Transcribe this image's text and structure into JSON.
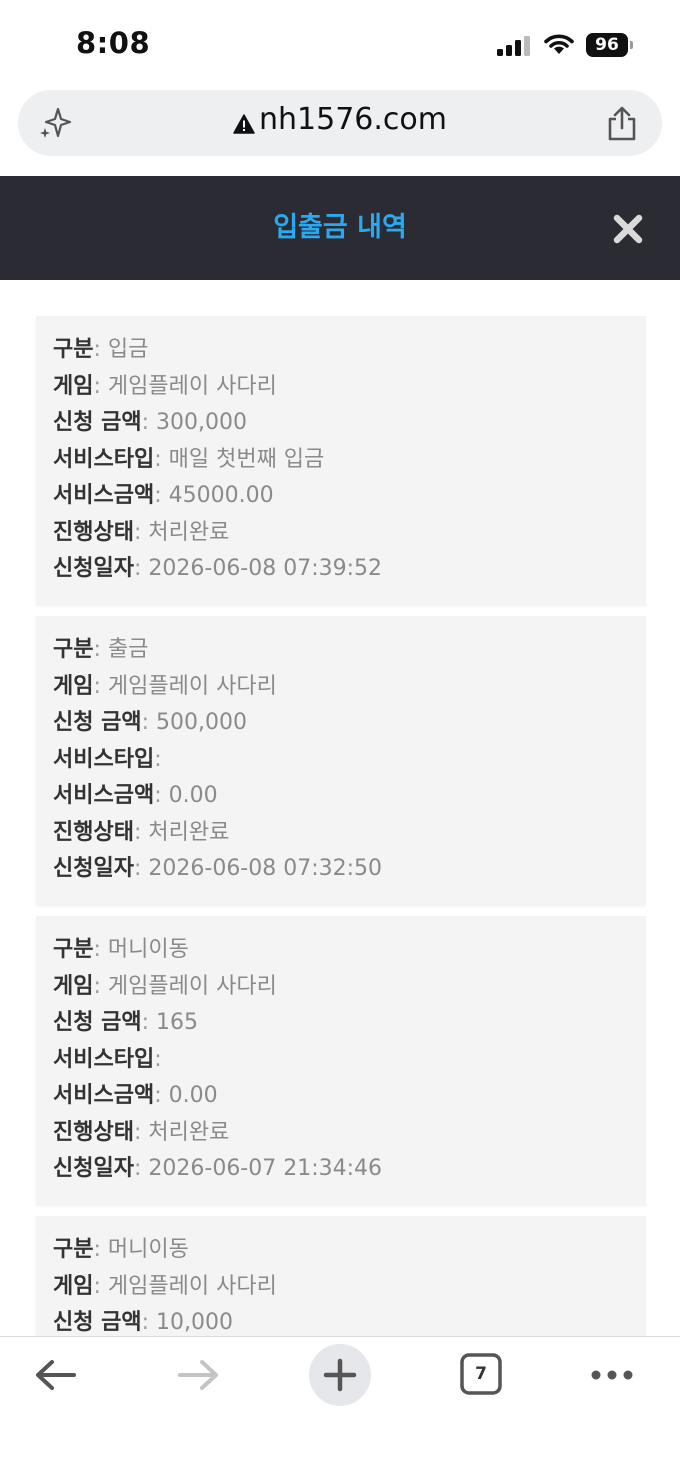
{
  "status_bar": {
    "time": "8:08",
    "battery": "96",
    "icons": [
      "cellular-signal-icon",
      "wifi-icon",
      "battery-icon"
    ]
  },
  "browser": {
    "url": "nh1576.com",
    "icons": [
      "sparkle-icon",
      "not-secure-warning-icon",
      "share-icon"
    ]
  },
  "modal": {
    "title": "입출금 내역",
    "close_icon": "close-icon"
  },
  "records": [
    {
      "labels": [
        "구분",
        "게임",
        "신청 금액",
        "서비스타입",
        "서비스금액",
        "진행상태",
        "신청일자"
      ],
      "values": [
        "입금",
        "게임플레이 사다리",
        "300,000",
        "매일 첫번째 입금",
        "45000.00",
        "처리완료",
        "2026-06-08 07:39:52"
      ]
    },
    {
      "labels": [
        "구분",
        "게임",
        "신청 금액",
        "서비스타입",
        "서비스금액",
        "진행상태",
        "신청일자"
      ],
      "values": [
        "출금",
        "게임플레이 사다리",
        "500,000",
        "",
        "0.00",
        "처리완료",
        "2026-06-08 07:32:50"
      ]
    },
    {
      "labels": [
        "구분",
        "게임",
        "신청 금액",
        "서비스타입",
        "서비스금액",
        "진행상태",
        "신청일자"
      ],
      "values": [
        "머니이동",
        "게임플레이 사다리",
        "165",
        "",
        "0.00",
        "처리완료",
        "2026-06-07 21:34:46"
      ]
    },
    {
      "labels": [
        "구분",
        "게임",
        "신청 금액"
      ],
      "values": [
        "머니이동",
        "게임플레이 사다리",
        "10,000"
      ]
    }
  ],
  "separator": ":",
  "toolbar": {
    "tab_count": "7",
    "icons": [
      "back-arrow-icon",
      "forward-arrow-icon",
      "plus-icon",
      "tabs-icon",
      "more-icon"
    ],
    "colors": {
      "active": "#555555",
      "disabled": "#c4c4c4"
    }
  },
  "colors": {
    "header_bg": "#2b2c33",
    "title": "#29a9f0",
    "card_bg": "#f4f4f4",
    "label": "#333333",
    "value": "#8a8a8a"
  }
}
